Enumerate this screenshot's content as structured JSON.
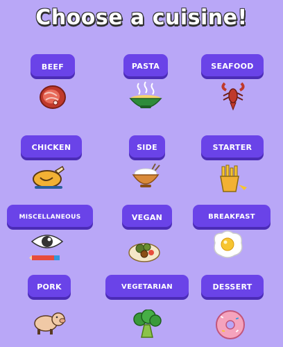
{
  "header": {
    "title": "Choose a cuisine!"
  },
  "cuisines": [
    {
      "label": "Beef",
      "icon": "steak-icon"
    },
    {
      "label": "Pasta",
      "icon": "noodle-bowl-icon"
    },
    {
      "label": "Seafood",
      "icon": "lobster-icon"
    },
    {
      "label": "Chicken",
      "icon": "roast-chicken-icon"
    },
    {
      "label": "Side",
      "icon": "rice-bowl-icon"
    },
    {
      "label": "Starter",
      "icon": "fries-icon"
    },
    {
      "label": "miscellaneous",
      "icon": "eye-pencil-icon"
    },
    {
      "label": "Vegan",
      "icon": "falafel-plate-icon"
    },
    {
      "label": "Breakfast",
      "icon": "fried-egg-icon"
    },
    {
      "label": "Pork",
      "icon": "pig-icon"
    },
    {
      "label": "Vegetarian",
      "icon": "broccoli-icon"
    },
    {
      "label": "Dessert",
      "icon": "donut-icon"
    }
  ],
  "colors": {
    "background": "#b9a7f7",
    "button": "#6a43e8",
    "button_shadow": "#4b2cb6",
    "text": "#ffffff"
  }
}
